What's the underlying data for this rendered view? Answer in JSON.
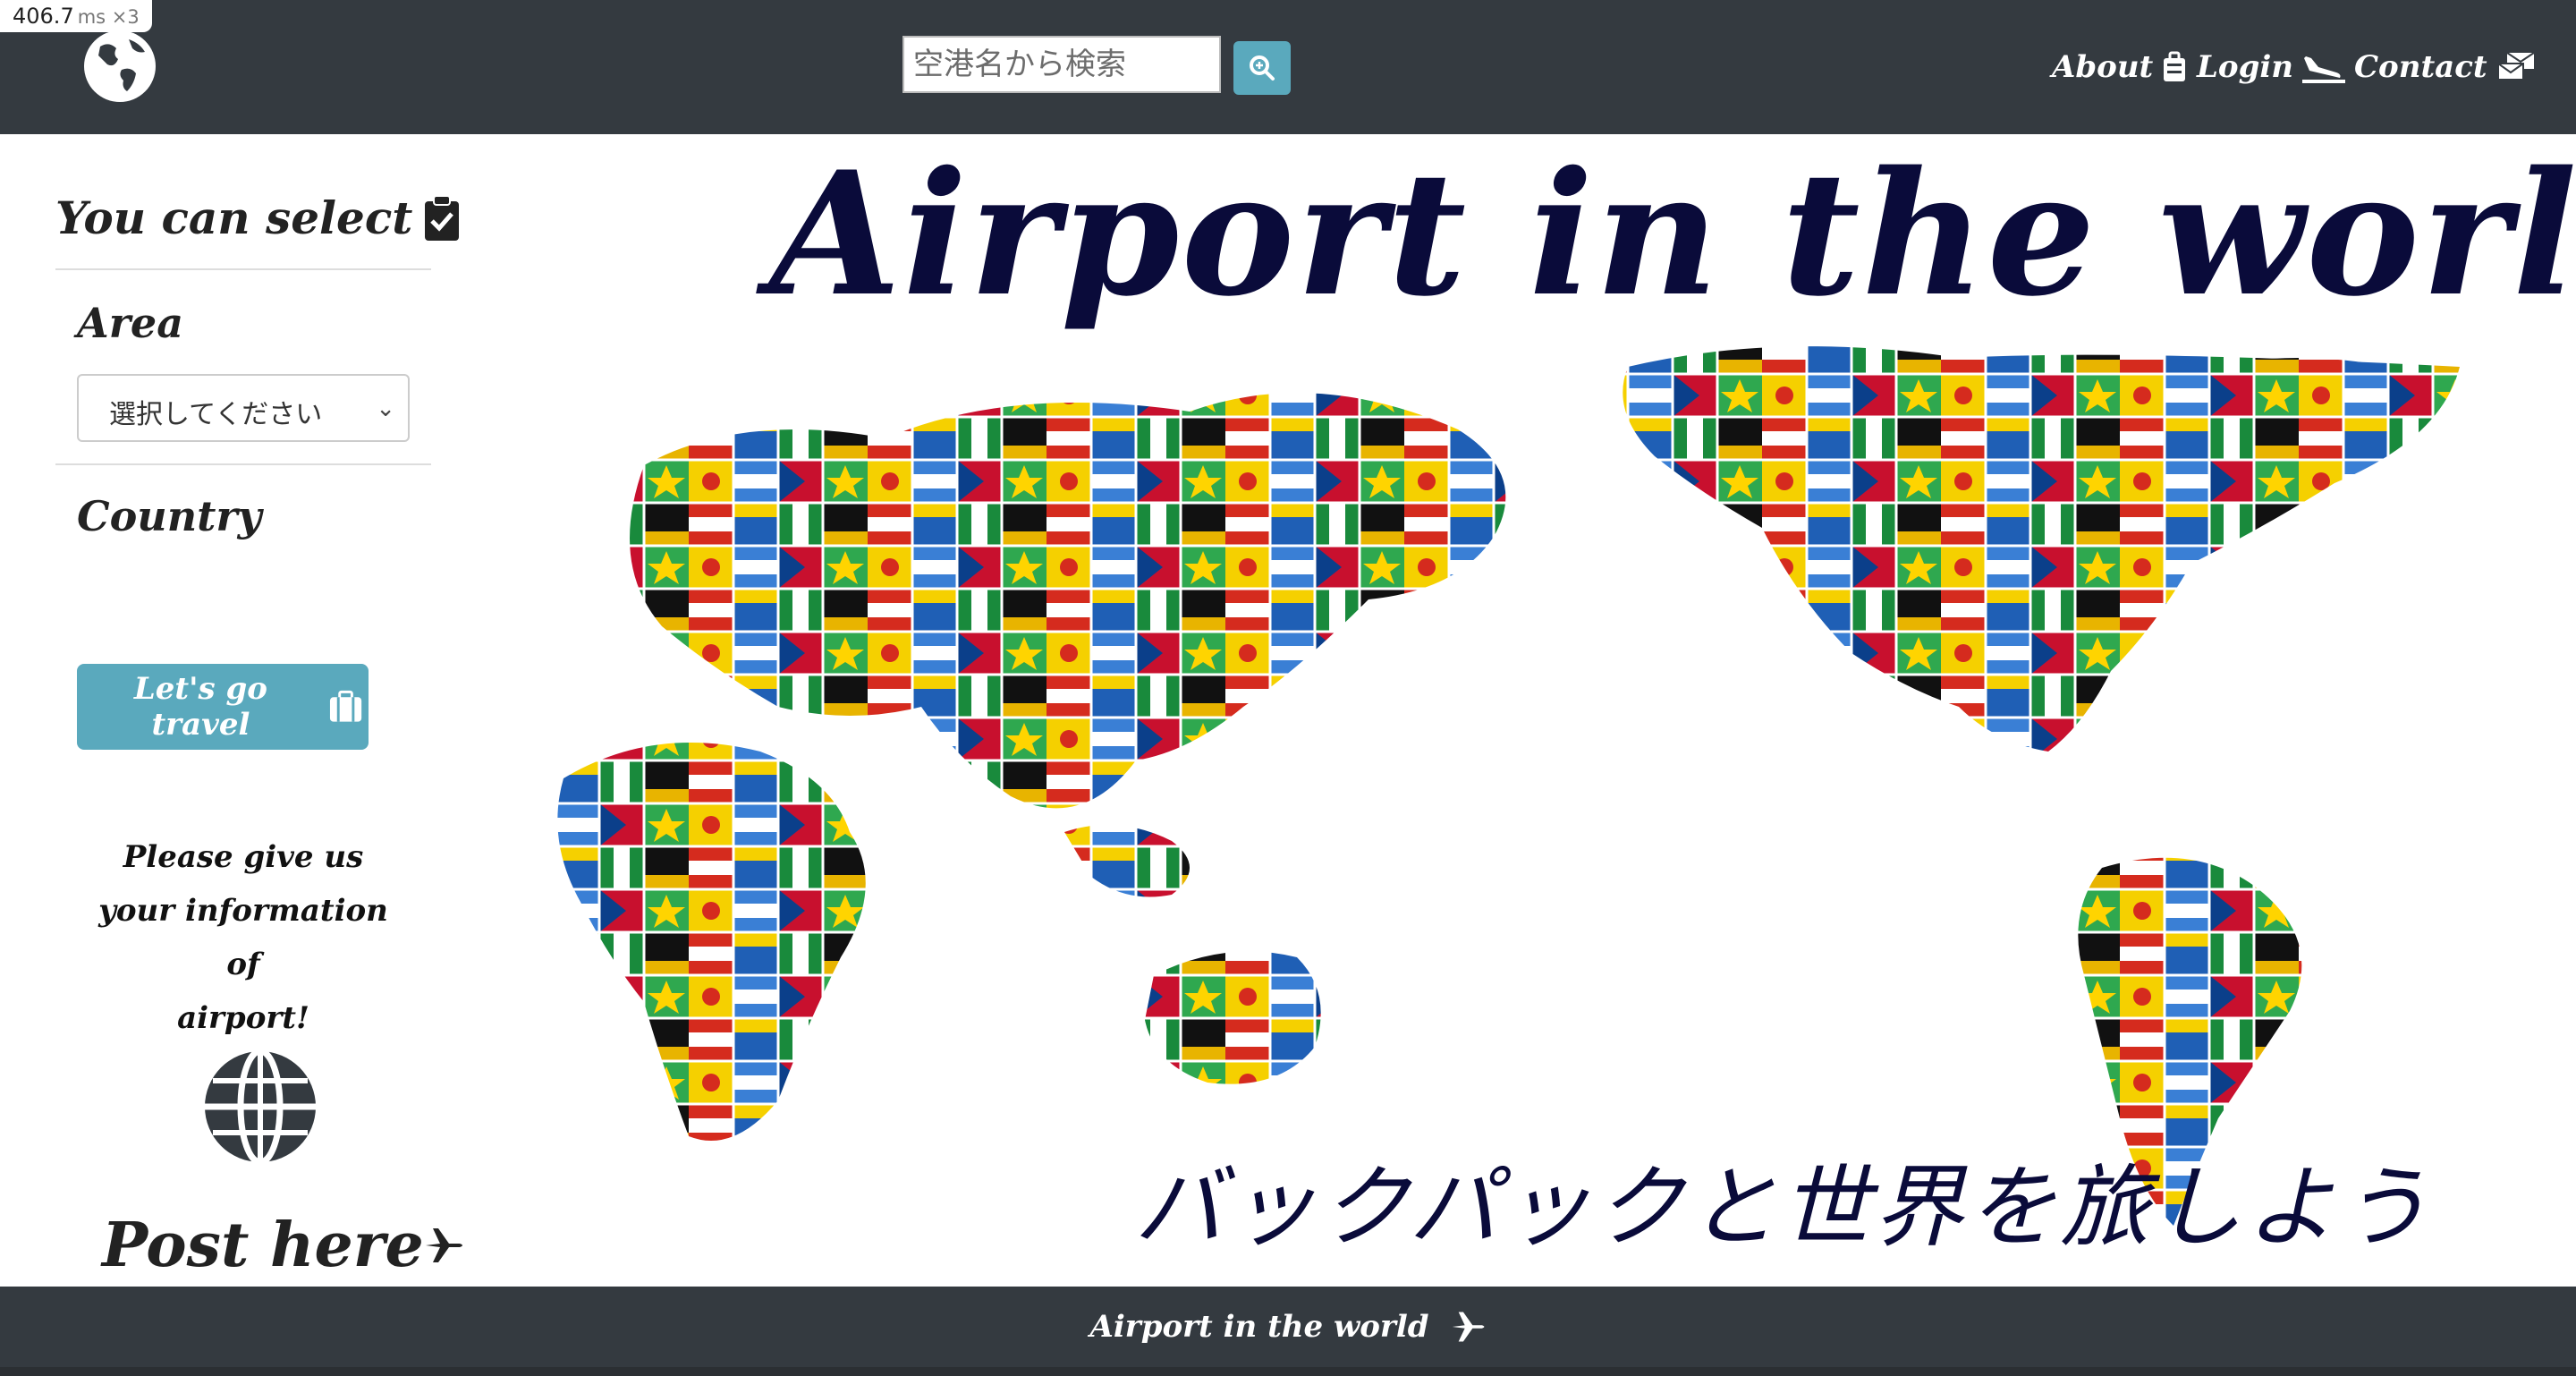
{
  "perf_badge": {
    "value": "406.7",
    "unit": "ms ×3"
  },
  "header": {
    "search_placeholder": "空港名から検索",
    "nav": [
      {
        "label": "About",
        "icon": "suitcase-icon"
      },
      {
        "label": "Login",
        "icon": "plane-landing-icon"
      },
      {
        "label": "Contact",
        "icon": "mailbox-icon"
      }
    ]
  },
  "sidebar": {
    "title": "You can select",
    "area_label": "Area",
    "area_select_value": "選択してください",
    "country_label": "Country",
    "go_button": "Let's go travel",
    "info_lines": [
      "Please give us",
      "your information of",
      "airport!"
    ],
    "post_label": "Post here"
  },
  "main": {
    "title": "Airport in the world",
    "subtitle_jp": "バックパックと世界を旅しよう"
  },
  "footer": {
    "text": "Airport in the world"
  },
  "colors": {
    "navbar": "#343a40",
    "accent": "#5aa9bd",
    "title": "#0a0b3a"
  }
}
